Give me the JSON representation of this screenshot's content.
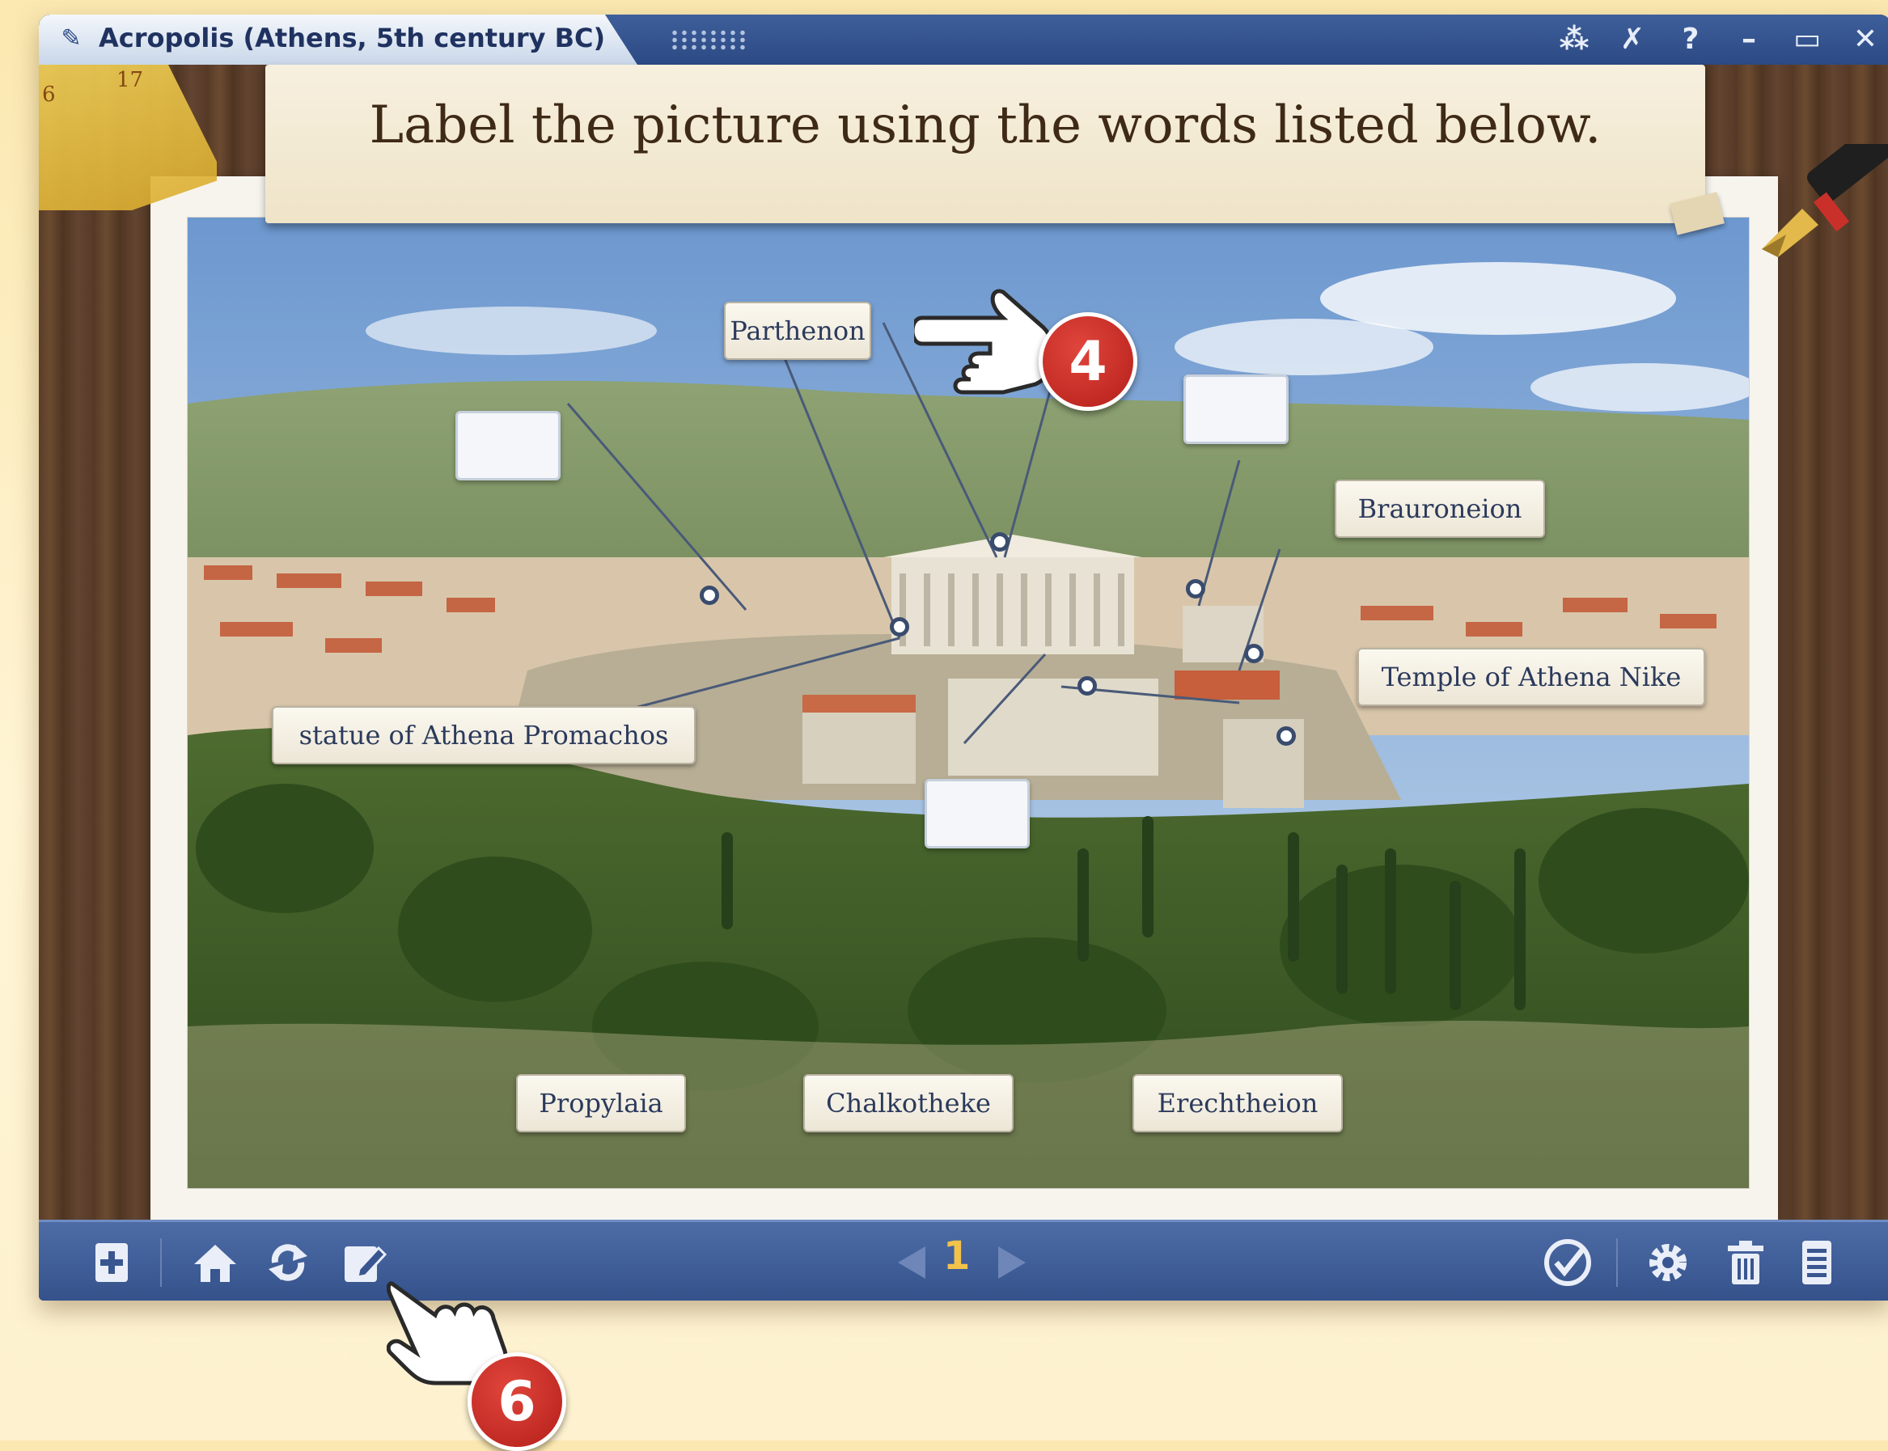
{
  "window": {
    "title": "Acropolis (Athens, 5th century BC)",
    "controls": [
      "resize-icon",
      "pin-icon",
      "help-icon",
      "minimize-icon",
      "maximize-icon",
      "close-icon"
    ]
  },
  "instruction": "Label the picture using the words listed below.",
  "ruler_marks": [
    "6",
    "17"
  ],
  "labels": {
    "parthenon": "Parthenon",
    "brauroneion": "Brauroneion",
    "temple_of_athena_nike": "Temple of Athena Nike",
    "statue_of_athena_promachos": "statue of Athena Promachos",
    "propylaia": "Propylaia",
    "chalkotheke": "Chalkotheke",
    "erechtheion": "Erechtheion"
  },
  "callouts": {
    "step_4": "4",
    "step_6": "6"
  },
  "pager": {
    "page": "1"
  },
  "colors": {
    "titlebar": "#2c4a84",
    "toolbar": "#3f5e97",
    "label_text": "#2b3a5c",
    "callout": "#c9302a"
  }
}
